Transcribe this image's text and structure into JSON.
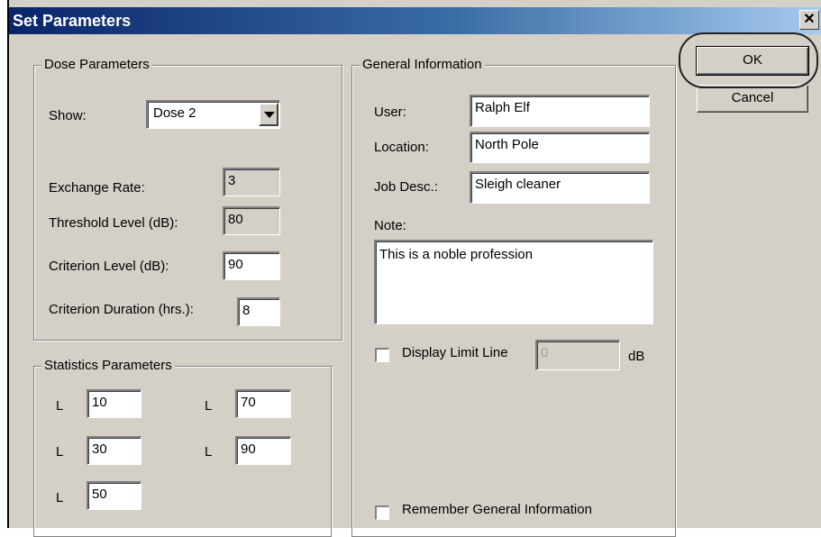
{
  "window": {
    "title": "Set Parameters",
    "close_glyph": "✕"
  },
  "dose": {
    "legend": "Dose Parameters",
    "show_label": "Show:",
    "show_value": "Dose 2",
    "exchange_rate_label": "Exchange Rate:",
    "exchange_rate_value": "3",
    "threshold_label": "Threshold Level (dB):",
    "threshold_value": "80",
    "criterion_level_label": "Criterion Level (dB):",
    "criterion_level_value": "90",
    "criterion_duration_label": "Criterion Duration (hrs.):",
    "criterion_duration_value": "8"
  },
  "stats": {
    "legend": "Statistics Parameters",
    "items": [
      {
        "label": "L",
        "value": "10"
      },
      {
        "label": "L",
        "value": "70"
      },
      {
        "label": "L",
        "value": "30"
      },
      {
        "label": "L",
        "value": "90"
      },
      {
        "label": "L",
        "value": "50"
      }
    ]
  },
  "general": {
    "legend": "General Information",
    "user_label": "User:",
    "user_value": "Ralph Elf",
    "location_label": "Location:",
    "location_value": "North Pole",
    "job_label": "Job Desc.:",
    "job_value": "Sleigh cleaner",
    "note_label": "Note:",
    "note_value": "This is a noble profession",
    "limit_label": "Display Limit Line",
    "limit_value": "0",
    "limit_unit": "dB",
    "limit_checked": false,
    "remember_label": "Remember General Information",
    "remember_checked": false
  },
  "buttons": {
    "ok": "OK",
    "cancel": "Cancel"
  },
  "icons": {
    "dropdown": "chevron-down-icon",
    "close": "close-icon"
  }
}
